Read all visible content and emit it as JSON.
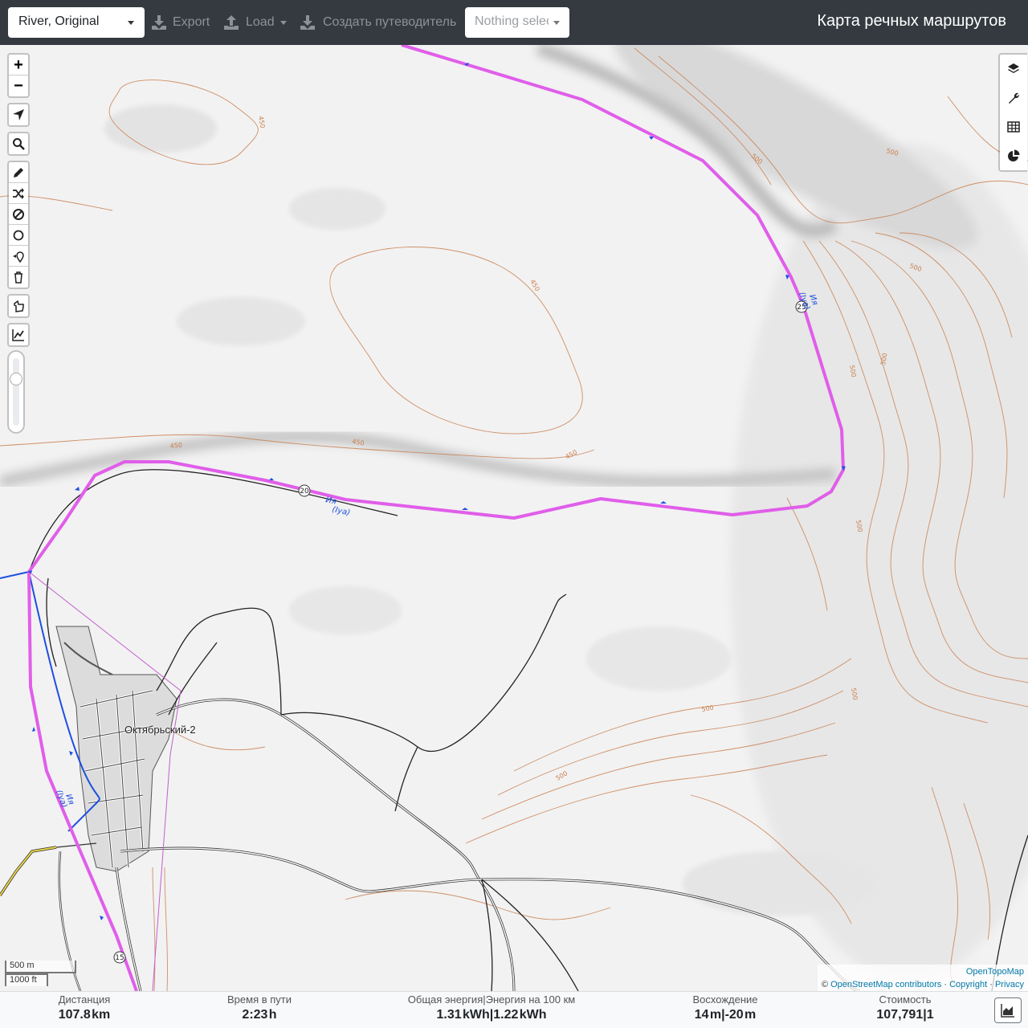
{
  "navbar": {
    "profile": "River, Original",
    "export_label": "Export",
    "load_label": "Load",
    "guide_label": "Создать путеводитель",
    "route_select_placeholder": "Nothing selected",
    "brand": "Карта речных маршрутов"
  },
  "map": {
    "settlement": "Октябрьский-2",
    "river_label_1": "Ия",
    "river_label_1b": "(Iya)",
    "river_label_2": "Ия",
    "river_label_2b": "(Iya)",
    "river_label_3": "Ия",
    "river_label_3b": "(Iya)",
    "markers": [
      "25",
      "20",
      "15"
    ],
    "contours": [
      "450",
      "450",
      "450",
      "450",
      "450",
      "500",
      "500",
      "500",
      "500",
      "500",
      "500",
      "500",
      "500",
      "500"
    ],
    "route_color": "#e05ee9",
    "river_color": "#1f4fe0",
    "contour_color": "#c97f4f",
    "road_color": "#2a2a2a"
  },
  "toolbar": {
    "zoom_in": "+",
    "zoom_out": "−",
    "icons": [
      "locate-icon",
      "search-icon",
      "draw-icon",
      "shuffle-icon",
      "avoid-icon",
      "circle-icon",
      "poi-icon",
      "delete-icon",
      "hand-icon",
      "elevation-chart-icon"
    ]
  },
  "layers": {
    "icons": [
      "layers-icon",
      "wrench-icon",
      "table-icon",
      "pie-chart-icon"
    ]
  },
  "scale": {
    "metric": "500 m",
    "imperial": "1000 ft"
  },
  "attribution": {
    "provider": "OpenTopoMap",
    "copyright_prefix": "©",
    "osm": "OpenStreetMap contributors",
    "sep1": "·",
    "copyright": "Copyright",
    "sep2": "·",
    "privacy": "Privacy"
  },
  "stats": {
    "distance": {
      "title": "Дистанция",
      "value": "107.8",
      "unit": "km"
    },
    "time": {
      "title": "Время в пути",
      "value": "2:23",
      "unit": "h"
    },
    "energy": {
      "title": "Общая энергия|Энергия на 100 км",
      "value1": "1.31",
      "unit1": "kWh",
      "sep": "|",
      "value2": "1.22",
      "unit2": "kWh"
    },
    "ascent": {
      "title": "Восхождение",
      "value1": "14",
      "unit1": "m",
      "sep": "|",
      "value2": "-20",
      "unit2": "m"
    },
    "cost": {
      "title": "Стоимость",
      "value": "107,791",
      "sep": "|",
      "value2": "1"
    }
  }
}
